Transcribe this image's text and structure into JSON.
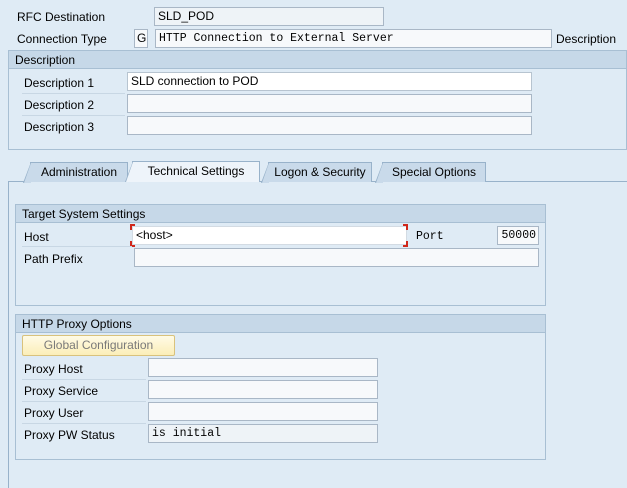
{
  "header": {
    "rfc_destination_label": "RFC Destination",
    "rfc_destination_value": "SLD_POD",
    "connection_type_label": "Connection Type",
    "connection_type_code": "G",
    "connection_type_desc": "HTTP Connection to External Server",
    "description_label": "Description"
  },
  "description_group": {
    "title": "Description",
    "rows": [
      {
        "label": "Description 1",
        "value": "SLD connection to POD"
      },
      {
        "label": "Description 2",
        "value": ""
      },
      {
        "label": "Description 3",
        "value": ""
      }
    ]
  },
  "tabs": [
    {
      "label": "Administration"
    },
    {
      "label": "Technical Settings"
    },
    {
      "label": "Logon & Security"
    },
    {
      "label": "Special Options"
    }
  ],
  "target_system": {
    "title": "Target System Settings",
    "host_label": "Host",
    "host_value": "<host>",
    "port_label": "Port",
    "port_value": "50000",
    "path_prefix_label": "Path Prefix",
    "path_prefix_value": ""
  },
  "proxy": {
    "title": "HTTP Proxy Options",
    "global_config_button": "Global Configuration",
    "proxy_host_label": "Proxy Host",
    "proxy_host_value": "",
    "proxy_service_label": "Proxy Service",
    "proxy_service_value": "",
    "proxy_user_label": "Proxy User",
    "proxy_user_value": "",
    "proxy_pw_status_label": "Proxy PW Status",
    "proxy_pw_status_value": "is initial"
  },
  "colors": {
    "background": "#dfebf5",
    "group_header": "#c6d8e8",
    "required_marker": "#d0281b",
    "button_fill": "#fbeeb8"
  }
}
